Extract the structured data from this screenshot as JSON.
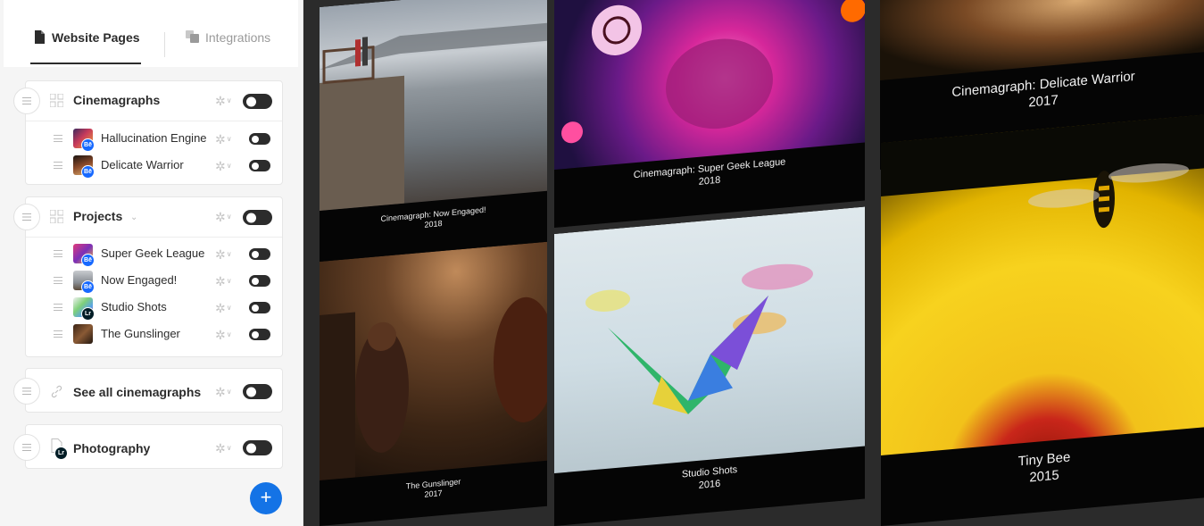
{
  "tabs": {
    "website_pages": "Website Pages",
    "integrations": "Integrations"
  },
  "sections": [
    {
      "title": "Cinemagraphs",
      "icon": "grid-icon",
      "items": [
        {
          "label": "Hallucination Engine",
          "badge": "Bē"
        },
        {
          "label": "Delicate Warrior",
          "badge": "Bē"
        }
      ]
    },
    {
      "title": "Projects",
      "icon": "grid-icon",
      "items": [
        {
          "label": "Super Geek League",
          "badge": "Bē"
        },
        {
          "label": "Now Engaged!",
          "badge": "Bē"
        },
        {
          "label": "Studio Shots",
          "badge": "Lr"
        },
        {
          "label": "The Gunslinger",
          "badge": ""
        }
      ]
    },
    {
      "title": "See all cinemagraphs",
      "icon": "link-icon",
      "items": []
    },
    {
      "title": "Photography",
      "icon": "page-icon",
      "badge": "Lr",
      "items": []
    }
  ],
  "add_button": "+",
  "preview": {
    "tiles": [
      {
        "title": "Cinemagraph: Now Engaged!",
        "year": "2018"
      },
      {
        "title": "Cinemagraph: Super Geek League",
        "year": "2018"
      },
      {
        "title": "Cinemagraph: Delicate Warrior",
        "year": "2017"
      },
      {
        "title": "The Gunslinger",
        "year": "2017"
      },
      {
        "title": "Studio Shots",
        "year": "2016"
      },
      {
        "title": "Tiny Bee",
        "year": "2015"
      }
    ]
  },
  "colors": {
    "accent": "#1473e6",
    "behance_badge": "#1769ff",
    "lightroom_badge": "#001d26",
    "toggle_on": "#2c2c2c",
    "preview_background": "#2b2b2b"
  }
}
